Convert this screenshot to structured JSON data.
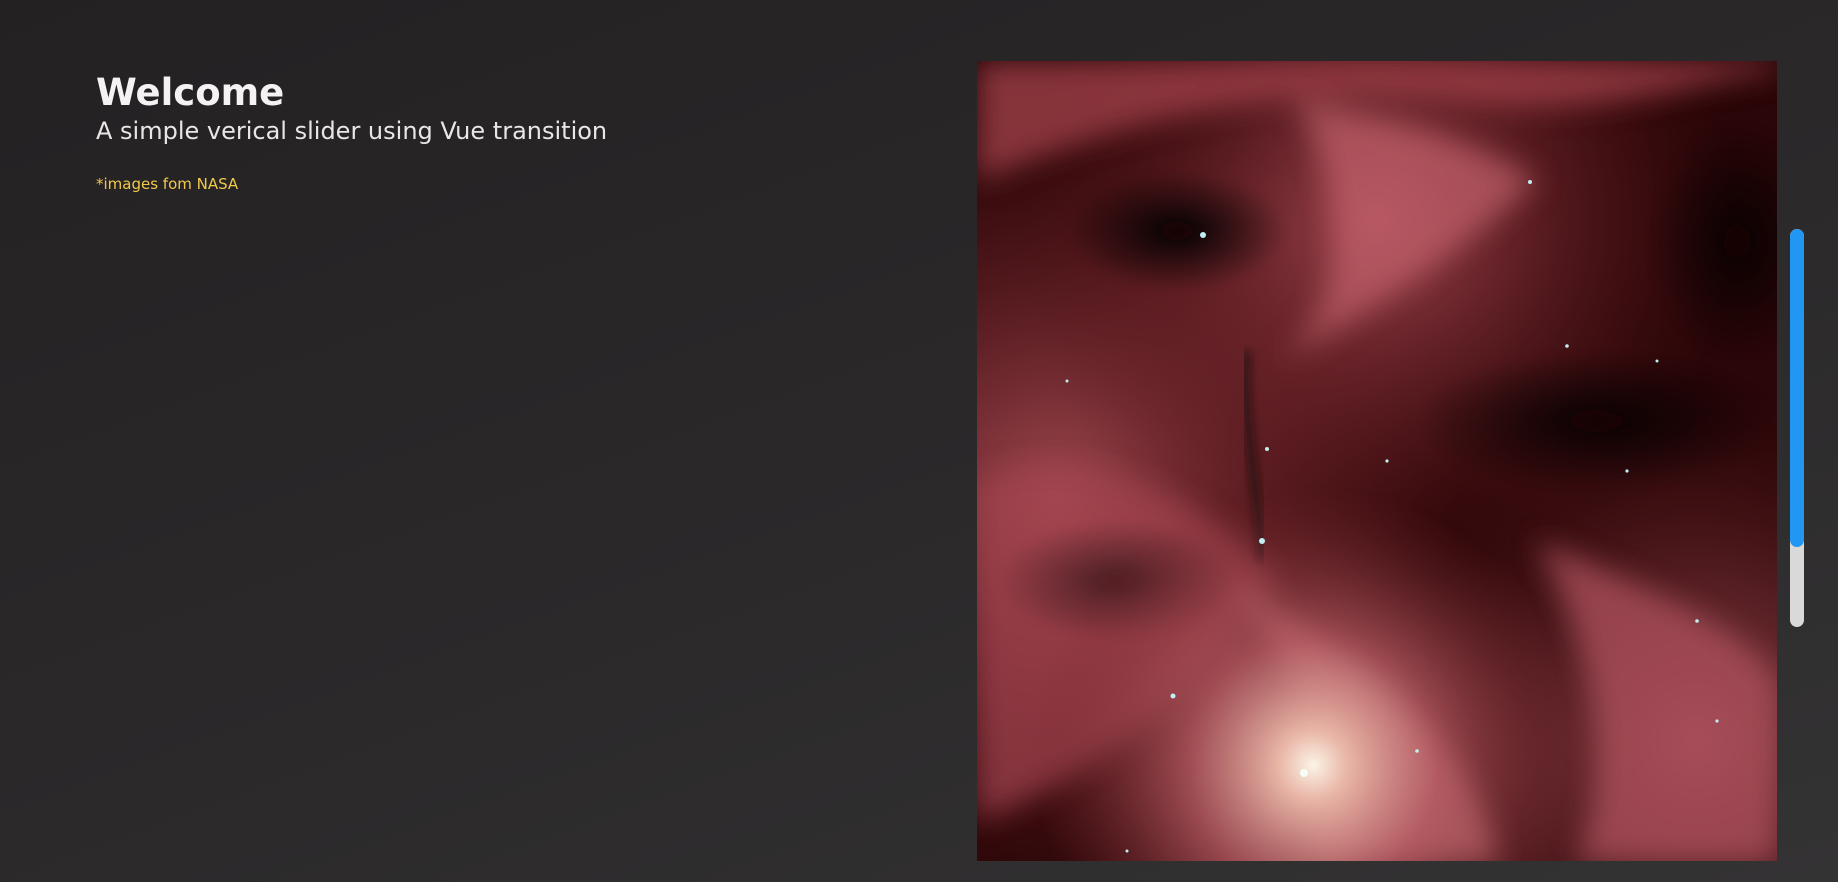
{
  "header": {
    "title": "Welcome",
    "subtitle": "A simple verical slider using Vue transition",
    "credit": "*images fom NASA"
  },
  "slider": {
    "current_image": "orion-nebula-infrared",
    "progress_fraction": 0.8
  },
  "colors": {
    "accent": "#2196f3",
    "credit": "#f2c84b",
    "track": "#d9d9d9"
  }
}
